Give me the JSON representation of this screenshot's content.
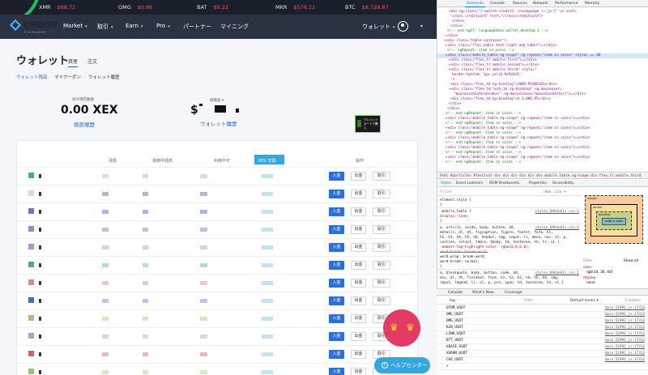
{
  "ticker": [
    {
      "symbol": "XMR",
      "price": "$68.72"
    },
    {
      "symbol": "OMG",
      "price": "$0.86"
    },
    {
      "symbol": "BAT",
      "price": "$0.22"
    },
    {
      "symbol": "MKR",
      "price": "$576.11"
    },
    {
      "symbol": "BTC",
      "price": "$8,728.87"
    }
  ],
  "navbar": {
    "logo": "CROSS",
    "logo_sub": "EXCHANGE",
    "items": [
      {
        "label": "Market"
      },
      {
        "label": "取引"
      },
      {
        "label": "Earn"
      },
      {
        "label": "Pro"
      },
      {
        "label": "パートナー"
      },
      {
        "label": "マイニング"
      }
    ],
    "wallet_menu": "ウォレット"
  },
  "page": {
    "title": "ウォレット",
    "tabs": [
      "資産",
      "注文"
    ],
    "subnav": [
      "ウォレット残高",
      "マイクーポン",
      "ウォレット履歴"
    ]
  },
  "summary": {
    "xex_label": "XEX現在数値",
    "xex_value": "0.00 XEX",
    "xex_link": "換部履歴",
    "usd_label": "総資産 ▾",
    "usd_prefix": "$",
    "usd_link": "ウォレット履歴",
    "credit_button": "クレジットカードで購入"
  },
  "table": {
    "headers": [
      "残高",
      "運用中残高",
      "利用不可",
      "XEX 交換",
      "操作"
    ],
    "rows_count_label": "",
    "actions": {
      "deposit": "入金",
      "withdraw": "出金",
      "history": "取引"
    }
  },
  "help_button": "ヘルプセンター",
  "devtools": {
    "tabs": [
      "Elements",
      "Console",
      "Sources",
      "Network",
      "Performance",
      "Memory"
    ],
    "elements_lines": [
      "<div ng-class=\"{'wallet-credit1':isLanguage !='ja'}\" ui-sref=",
      "\"cross.creditcard\" href=\"/cross/creditcard\">",
      "</div>",
      "</div>",
      "<!-- end ngIf: languageData.wallet_desktop_1 -->",
      "</div>",
      "▾<div class=\"table-container\">",
      "▸<div class=\"flex_table text-right web_table\">…</div>",
      "<!-- ngRepeat: item in coins -->",
      "▸<div class=\"mobile_table ng-scope\" ng-repeat=\"item in coins\" style> == $0",
      "▸<div class=\"flex_tr mobile_first\">…</div>",
      "▸<div class=\"flex_tr mobile_second\">…</div>",
      "▾<div class=\"flex_tr mobile_third\" style=\"",
      "border-bottom: 1px solid #e5e5e5;",
      "\">",
      "<div class=\"flex_td ng-binding\">1009.95406181</div>",
      "▾<div class=\"flex_td lock_td ng-binding\" ng-mouseover=",
      "\"mouseLockInfo($index)\" ng-mouseleave=\"mouseLockInfo()\">…</div>",
      "<div class=\"flex_td ng-binding\">$ 1,009.95</div>",
      "</div>",
      "</div>",
      "<!-- end ngRepeat: item in coins -->",
      "▸<div class=\"mobile_table ng-scope\" ng-repeat=\"item in coins\">…</div>",
      "<!-- end ngRepeat: item in coins -->",
      "▸<div class=\"mobile_table ng-scope\" ng-repeat=\"item in coins\">…</div>",
      "<!-- end ngRepeat: item in coins -->",
      "▸<div class=\"mobile_table ng-scope\" ng-repeat=\"item in coins\">…</div>",
      "<!-- end ngRepeat: item in coins -->",
      "▸<div class=\"mobile_table ng-scope\" ng-repeat=\"item in coins\">…</div>",
      "<!-- end ngRepeat: item in coins -->",
      "▸<div class=\"mobile_table ng-scope\" ng-repeat=\"item in coins\">…</div>",
      "<!-- end ngRepeat: item in coins -->"
    ],
    "breadcrumb": "html  #particles  #festival  div  div  div  div  div  div.mobile_table.ng-scope  div.flex_tr.mobile_third",
    "styles_tabs": [
      "Styles",
      "Event Listeners",
      "DOM Breakpoints",
      "Properties",
      "Accessibility"
    ],
    "filter_placeholder": "Filter",
    "filter_opts": ":hov  .cls  +",
    "styles_lines": [
      {
        "t": "element.style {",
        "src": ""
      },
      {
        "t": "}",
        "src": ""
      },
      {
        "t": ".mobile_table {",
        "src": "styles.69b4e61c.css:1"
      },
      {
        "t": "  display: none;",
        "src": ""
      },
      {
        "t": "}",
        "src": ""
      },
      {
        "t": "a, article, aside, body, button, dd,",
        "src": "styles.69b4e61c.css:1"
      },
      {
        "t": "details, dl, dt, figcaption, figure, footer, form, h1,",
        "src": ""
      },
      {
        "t": "h2, h3, h4, h5, h6, header, img, input, li, menu, nav, ol, p,",
        "src": ""
      },
      {
        "t": "section, select, table, tbody, td, textarea, th, tr, ul {",
        "src": ""
      },
      {
        "t": "  -webkit-tap-highlight-color: rgba(0,0,0,0);",
        "src": ""
      },
      {
        "t": "  word-break: break-word;",
        "src": ""
      },
      {
        "t": "  word-wrap: break-word;",
        "src": ""
      },
      {
        "t": "  word-break: normal;",
        "src": ""
      },
      {
        "t": "}",
        "src": ""
      },
      {
        "t": "a, blockquote, body, button, code, dd,",
        "src": "styles.69b4e61c.css:1"
      },
      {
        "t": "div, dl, dt, fieldset, form, h1, h2, h3, h4, h5, h6, img,",
        "src": ""
      },
      {
        "t": "input, legend, li, ol, p, pre, span, td, textarea, th, ul {",
        "src": ""
      }
    ],
    "boxmodel": {
      "margin": "margin",
      "border": "border",
      "padding": "padding",
      "content": "auto × auto",
      "dash": "–"
    },
    "computed": {
      "filter": "Filter",
      "show_all": "Show all",
      "color_prop": "color",
      "color_val": "rgb(34, 36, 40)",
      "display_prop": "display",
      "display_val": "none"
    },
    "console_tabs": [
      "Console",
      "What's New",
      "Coverage"
    ],
    "console_context": "top",
    "console_filter": "Filter",
    "console_levels": "Default levels ▾",
    "console_hidden": "1 hidden",
    "console_lines": [
      {
        "msg": "QTUM_USDT",
        "src": "main.51992.js:17313"
      },
      {
        "msg": "OMG_USDT",
        "src": "main.51992.js:17313"
      },
      {
        "msg": "OMG_USDT",
        "src": "main.51992.js:17313"
      },
      {
        "msg": "KLM_USDT",
        "src": "main.51992.js:17313"
      },
      {
        "msg": "LINK_USDT",
        "src": "main.51992.js:17313"
      },
      {
        "msg": "BTT_USDT",
        "src": "main.51992.js:17313"
      },
      {
        "msg": "XEACE_USDT",
        "src": "main.51992.js:17313"
      },
      {
        "msg": "XGRAM_USDT",
        "src": "main.51992.js:17313"
      },
      {
        "msg": "CHZ_USDT",
        "src": "main.51992.js:17313"
      },
      {
        "msg": ">",
        "src": ""
      }
    ]
  }
}
